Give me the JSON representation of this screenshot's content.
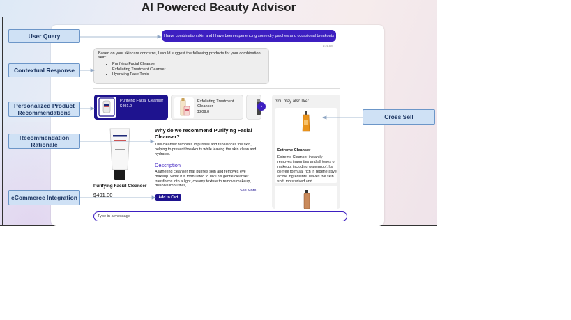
{
  "title": "AI Powered Beauty Advisor",
  "callouts": {
    "user_query": "User Query",
    "contextual_response": "Contextual Response",
    "personalized_recommendations": "Personalized Product Recommendations",
    "recommendation_rationale": "Recommendation Rationale",
    "ecommerce_integration": "eCommerce Integration",
    "cross_sell": "Cross Sell"
  },
  "chat": {
    "user_message": "I have combination skin and I have been experiencing some dry patches and occasional breakouts",
    "timestamp": "1:21 AM",
    "response_intro": "Based on your skincare concerns, I would suggest the following products for your combination skin:",
    "response_items": [
      "Purifying Facial Cleanser",
      "Exfoliating Treatment Cleanser",
      "Hydrating Face Tonic"
    ],
    "input_placeholder": "Type in a message"
  },
  "products": [
    {
      "name": "Purifying Facial Cleanser",
      "price": "$491.0",
      "selected": true
    },
    {
      "name": "Exfoliating Treatment Cleanser",
      "price": "$209.0",
      "selected": false
    }
  ],
  "detail": {
    "product_name": "Purifying Facial Cleanser",
    "price": "$491.00",
    "why_title": "Why do we recommend Purifying Facial Cleanser?",
    "why_text": "This cleanser removes impurities and rebalances the skin, helping to prevent breakouts while leaving the skin clean and hydrated.",
    "description_title": "Description",
    "description_text": "A lathering cleanser that purifies skin and removes eye makeup. What it is formulated to do:This gentle cleanser transforms into a light, creamy texture to remove makeup, dissolve impurities,",
    "see_more": "See More",
    "add_to_cart": "Add to Cart"
  },
  "cross_sell": {
    "heading": "You may also like:",
    "item_name": "Extreme Cleanser",
    "item_text": "Extreme Cleanser instantly removes impurities and all types of makeup, including waterproof. Its oil-free formula, rich in regenerative active ingredients, leaves the skin soft, moisturized and..."
  },
  "colors": {
    "accent": "#3d1fc1",
    "accent_dark": "#1e138f",
    "callout_fill": "#cfe1f5",
    "callout_border": "#6c96c8"
  }
}
